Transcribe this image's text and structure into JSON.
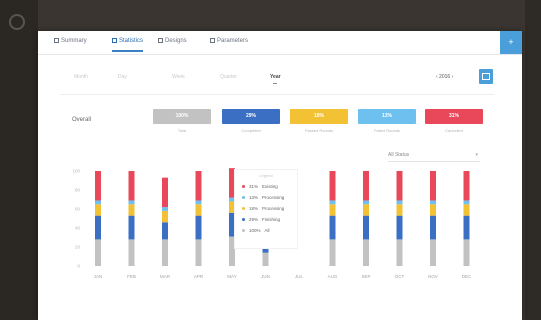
{
  "tabs": [
    {
      "label": "Summary",
      "active": false
    },
    {
      "label": "Statistics",
      "active": true
    },
    {
      "label": "Designs",
      "active": false
    },
    {
      "label": "Parameters",
      "active": false
    }
  ],
  "corner_button_icon": "plus-icon",
  "filters": [
    {
      "label": "Month",
      "active": false
    },
    {
      "label": "Day",
      "active": false
    },
    {
      "label": "Week",
      "active": false
    },
    {
      "label": "Quarter",
      "active": false
    },
    {
      "label": "Year",
      "active": true
    }
  ],
  "year_select": "‹ 2016 ›",
  "summary_label": "Overall",
  "cards": [
    {
      "value": "100%",
      "caption": "Total",
      "color": "#c2c2c2"
    },
    {
      "value": "29%",
      "caption": "Completed",
      "color": "#3a6fc4"
    },
    {
      "value": "18%",
      "caption": "Passed Rounds",
      "color": "#f3c234"
    },
    {
      "value": "13%",
      "caption": "Failed Rounds",
      "color": "#6ec0ef"
    },
    {
      "value": "31%",
      "caption": "Cancelled",
      "color": "#e8485a"
    }
  ],
  "dropdown": {
    "label": "All Status",
    "caret": "▾"
  },
  "legend": {
    "title": "Legend",
    "items": [
      {
        "pct": "31%",
        "label": "Existing",
        "color": "#e8485a"
      },
      {
        "pct": "13%",
        "label": "Processing",
        "color": "#6ec0ef"
      },
      {
        "pct": "18%",
        "label": "Processing",
        "color": "#f3c234"
      },
      {
        "pct": "29%",
        "label": "Finishing",
        "color": "#3a6fc4"
      },
      {
        "pct": "100%",
        "label": "All",
        "color": "#c2c2c2"
      }
    ]
  },
  "chart_data": {
    "type": "bar",
    "stacked": true,
    "categories": [
      "JAN",
      "FEB",
      "MAR",
      "APR",
      "MAY",
      "JUN",
      "JUL",
      "AUG",
      "SEP",
      "OCT",
      "NOV",
      "DEC"
    ],
    "y_ticks": [
      "100",
      "80",
      "60",
      "40",
      "20",
      "0"
    ],
    "ylim": [
      0,
      100
    ],
    "series": [
      {
        "name": "All",
        "color": "#c2c2c2",
        "values": [
          28,
          28,
          28,
          28,
          31,
          14,
          0,
          28,
          28,
          28,
          28,
          28
        ]
      },
      {
        "name": "Finishing",
        "color": "#3a6fc4",
        "values": [
          25,
          25,
          18,
          25,
          25,
          14,
          0,
          25,
          25,
          25,
          25,
          25
        ]
      },
      {
        "name": "Processing",
        "color": "#f3c234",
        "values": [
          12,
          12,
          12,
          12,
          12,
          0,
          0,
          12,
          12,
          12,
          12,
          12
        ]
      },
      {
        "name": "Processing",
        "color": "#6ec0ef",
        "values": [
          4,
          4,
          4,
          4,
          4,
          0,
          0,
          4,
          4,
          4,
          4,
          4
        ]
      },
      {
        "name": "Existing",
        "color": "#e8485a",
        "values": [
          31,
          31,
          31,
          31,
          31,
          0,
          0,
          31,
          31,
          31,
          31,
          31
        ]
      }
    ],
    "legend_position": "top-center"
  }
}
